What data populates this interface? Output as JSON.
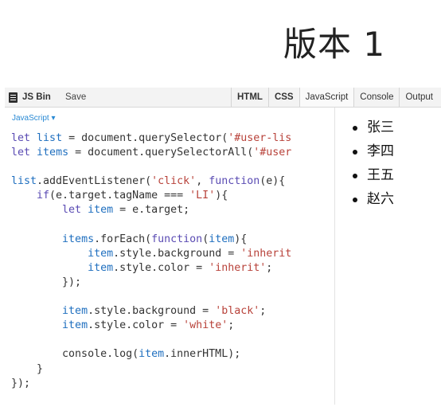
{
  "slide": {
    "title": "版本 1"
  },
  "jsbin": {
    "brand": "JS Bin",
    "save": "Save",
    "tabs": [
      "HTML",
      "CSS",
      "JavaScript",
      "Console",
      "Output"
    ],
    "editor": {
      "language": "JavaScript ▾",
      "code_lines": [
        "let list = document.querySelector('#user-lis",
        "let items = document.querySelectorAll('#user",
        "",
        "list.addEventListener('click', function(e){",
        "    if(e.target.tagName === 'LI'){",
        "        let item = e.target;",
        "",
        "        items.forEach(function(item){",
        "            item.style.background = 'inherit",
        "            item.style.color = 'inherit';",
        "        });",
        "",
        "        item.style.background = 'black';",
        "        item.style.color = 'white';",
        "",
        "        console.log(item.innerHTML);",
        "    }",
        "});"
      ]
    },
    "output": {
      "items": [
        "张三",
        "李四",
        "王五",
        "赵六"
      ]
    }
  },
  "colors": {
    "keyword": "#5a4bb3",
    "variable": "#1f6fbf",
    "string": "#b8423a",
    "label": "#2a8ad4"
  }
}
